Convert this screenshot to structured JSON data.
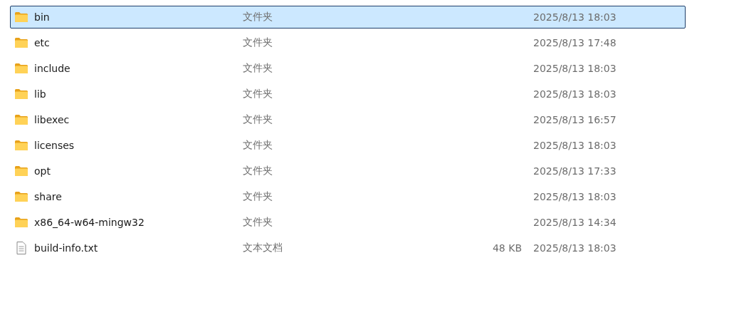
{
  "files": [
    {
      "kind": "folder",
      "name": "bin",
      "type": "文件夹",
      "modified": "2025/8/13 18:03",
      "selected": true
    },
    {
      "kind": "folder",
      "name": "etc",
      "type": "文件夹",
      "modified": "2025/8/13 17:48",
      "selected": false
    },
    {
      "kind": "folder",
      "name": "include",
      "type": "文件夹",
      "modified": "2025/8/13 18:03",
      "selected": false
    },
    {
      "kind": "folder",
      "name": "lib",
      "type": "文件夹",
      "modified": "2025/8/13 18:03",
      "selected": false
    },
    {
      "kind": "folder",
      "name": "libexec",
      "type": "文件夹",
      "modified": "2025/8/13 16:57",
      "selected": false
    },
    {
      "kind": "folder",
      "name": "licenses",
      "type": "文件夹",
      "modified": "2025/8/13 18:03",
      "selected": false
    },
    {
      "kind": "folder",
      "name": "opt",
      "type": "文件夹",
      "modified": "2025/8/13 17:33",
      "selected": false
    },
    {
      "kind": "folder",
      "name": "share",
      "type": "文件夹",
      "modified": "2025/8/13 18:03",
      "selected": false
    },
    {
      "kind": "folder",
      "name": "x86_64-w64-mingw32",
      "type": "文件夹",
      "modified": "2025/8/13 14:34",
      "selected": false
    },
    {
      "kind": "file",
      "name": "build-info.txt",
      "type": "文本文档",
      "size": "48 KB",
      "modified": "2025/8/13 18:03",
      "selected": false
    }
  ]
}
